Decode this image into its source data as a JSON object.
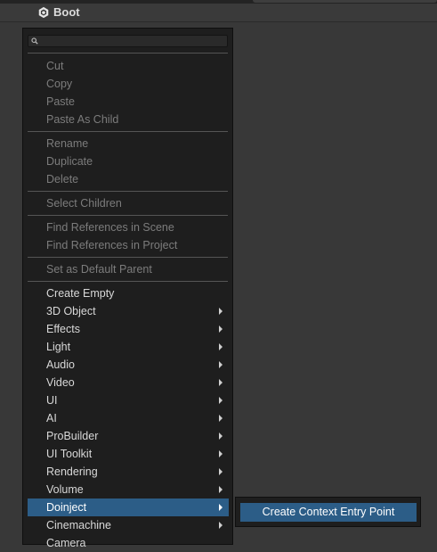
{
  "header": {
    "title": "Boot",
    "icon": "unity-gameobject-icon"
  },
  "search": {
    "value": "",
    "icon": "search-icon"
  },
  "menu": {
    "items": [
      {
        "label": "Cut",
        "enabled": false,
        "submenu": false
      },
      {
        "label": "Copy",
        "enabled": false,
        "submenu": false
      },
      {
        "label": "Paste",
        "enabled": false,
        "submenu": false
      },
      {
        "label": "Paste As Child",
        "enabled": false,
        "submenu": false
      },
      {
        "label": "Rename",
        "enabled": false,
        "submenu": false
      },
      {
        "label": "Duplicate",
        "enabled": false,
        "submenu": false
      },
      {
        "label": "Delete",
        "enabled": false,
        "submenu": false
      },
      {
        "label": "Select Children",
        "enabled": false,
        "submenu": false
      },
      {
        "label": "Find References in Scene",
        "enabled": false,
        "submenu": false
      },
      {
        "label": "Find References in Project",
        "enabled": false,
        "submenu": false
      },
      {
        "label": "Set as Default Parent",
        "enabled": false,
        "submenu": false
      },
      {
        "label": "Create Empty",
        "enabled": true,
        "submenu": false
      },
      {
        "label": "3D Object",
        "enabled": true,
        "submenu": true
      },
      {
        "label": "Effects",
        "enabled": true,
        "submenu": true
      },
      {
        "label": "Light",
        "enabled": true,
        "submenu": true
      },
      {
        "label": "Audio",
        "enabled": true,
        "submenu": true
      },
      {
        "label": "Video",
        "enabled": true,
        "submenu": true
      },
      {
        "label": "UI",
        "enabled": true,
        "submenu": true
      },
      {
        "label": "AI",
        "enabled": true,
        "submenu": true
      },
      {
        "label": "ProBuilder",
        "enabled": true,
        "submenu": true
      },
      {
        "label": "UI Toolkit",
        "enabled": true,
        "submenu": true
      },
      {
        "label": "Rendering",
        "enabled": true,
        "submenu": true
      },
      {
        "label": "Volume",
        "enabled": true,
        "submenu": true
      },
      {
        "label": "Doinject",
        "enabled": true,
        "submenu": true,
        "highlighted": true
      },
      {
        "label": "Cinemachine",
        "enabled": true,
        "submenu": true
      },
      {
        "label": "Camera",
        "enabled": true,
        "submenu": false
      }
    ]
  },
  "submenu": {
    "items": [
      {
        "label": "Create Context Entry Point",
        "highlighted": true
      }
    ]
  },
  "colors": {
    "highlight": "#2c5d87",
    "menu_bg": "#1e1e1e",
    "disabled_text": "#7c7c7c"
  }
}
